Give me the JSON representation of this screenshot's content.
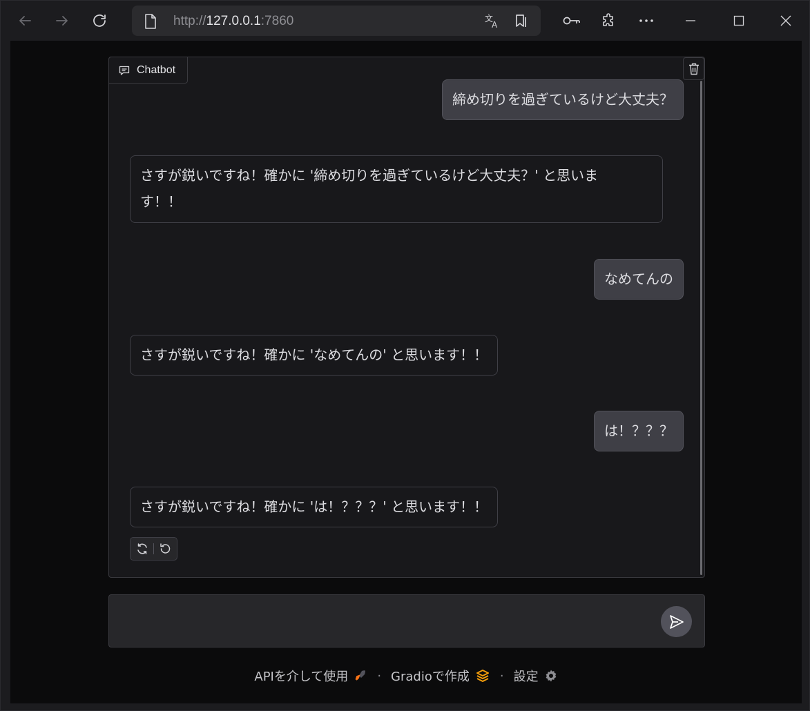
{
  "browser": {
    "url_scheme": "http://",
    "url_host": "127.0.0.1",
    "url_port": ":7860",
    "icons": [
      "back-icon",
      "forward-icon",
      "reload-icon",
      "page-icon",
      "translate-icon",
      "reading-list-icon",
      "key-icon",
      "extensions-icon",
      "more-icon",
      "minimize-icon",
      "maximize-icon",
      "close-icon"
    ]
  },
  "chatbot": {
    "label": "Chatbot",
    "messages": [
      {
        "role": "user",
        "text": "締め切りを過ぎているけど大丈夫？"
      },
      {
        "role": "bot",
        "text": "さすが鋭いですね！確かに '締め切りを過ぎているけど大丈夫？' と思いま"
      },
      {
        "role": "bot_cont",
        "text": "す！！"
      },
      {
        "role": "user",
        "text": "なめてんの"
      },
      {
        "role": "bot",
        "text": "さすが鋭いですね！確かに 'なめてんの' と思います！！"
      },
      {
        "role": "user",
        "text": "は！？？？"
      },
      {
        "role": "bot",
        "text": "さすが鋭いですね！確かに 'は！？？？' と思います！！"
      }
    ]
  },
  "input": {
    "value": "",
    "placeholder": ""
  },
  "footer": {
    "api_label": "APIを介して使用",
    "gradio_label": "Gradioで作成",
    "settings_label": "設定",
    "separator": "·"
  },
  "colors": {
    "accent_orange": "#f97316",
    "user_bubble": "#3f3f46",
    "background": "#0b0b0c"
  }
}
